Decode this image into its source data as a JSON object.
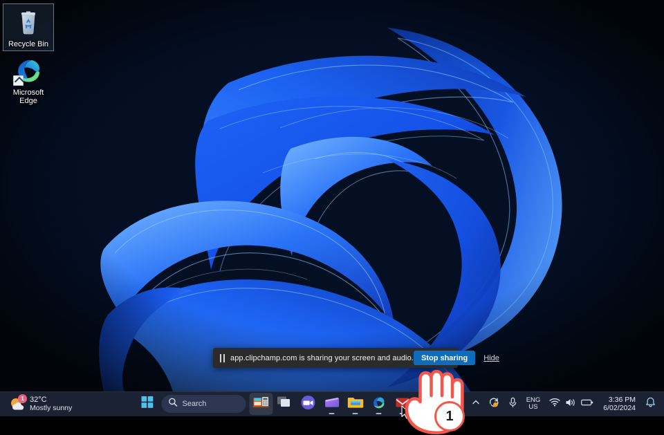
{
  "desktop": {
    "icons": [
      {
        "name": "recycle-bin",
        "label": "Recycle Bin",
        "selected": true
      },
      {
        "name": "microsoft-edge",
        "label": "Microsoft Edge",
        "line1": "Microsoft",
        "line2": "Edge",
        "shortcut": true
      }
    ]
  },
  "share_bar": {
    "pause_icon": "pause-icon",
    "message": "app.clipchamp.com is sharing your screen and audio.",
    "stop_label": "Stop sharing",
    "hide_label": "Hide",
    "background": "#2b2b2b",
    "button_color": "#0f6cbd"
  },
  "taskbar": {
    "background": "#1b2233",
    "weather": {
      "temperature": "32°C",
      "condition": "Mostly sunny",
      "badge_count": "1",
      "icon": "sun-cloud-icon"
    },
    "start": {
      "label": "Start",
      "icon": "windows-logo-icon"
    },
    "search": {
      "placeholder": "Search",
      "icon": "search-icon"
    },
    "apps": [
      {
        "name": "widgets",
        "icon": "widgets-icon",
        "active_bg": true,
        "running": false
      },
      {
        "name": "task-view",
        "icon": "task-view-icon",
        "active_bg": false,
        "running": false
      },
      {
        "name": "microsoft-teams",
        "icon": "teams-icon",
        "active_bg": false,
        "running": false
      },
      {
        "name": "clipchamp",
        "icon": "clipchamp-icon",
        "active_bg": false,
        "running": true
      },
      {
        "name": "file-explorer",
        "icon": "file-explorer-icon",
        "active_bg": false,
        "running": true
      },
      {
        "name": "microsoft-edge",
        "icon": "edge-icon",
        "active_bg": false,
        "running": true
      },
      {
        "name": "mail",
        "icon": "mail-icon",
        "active_bg": false,
        "running": true
      },
      {
        "name": "snipping-tool",
        "icon": "snipping-tool-icon",
        "active_bg": false,
        "running": true
      }
    ],
    "tray": {
      "overflow_icon": "chevron-up-icon",
      "sync_icon": "sync-icon",
      "microphone_icon": "microphone-icon",
      "language_line1": "ENG",
      "language_line2": "US",
      "wifi_icon": "wifi-icon",
      "volume_icon": "speaker-icon",
      "battery_icon": "battery-icon",
      "time": "3:36 PM",
      "date": "6/02/2024",
      "notification_icon": "bell-icon"
    }
  },
  "annotation": {
    "step_number": "1",
    "hand_icon": "pointing-hand-icon",
    "accent_color": "#f4564a"
  }
}
